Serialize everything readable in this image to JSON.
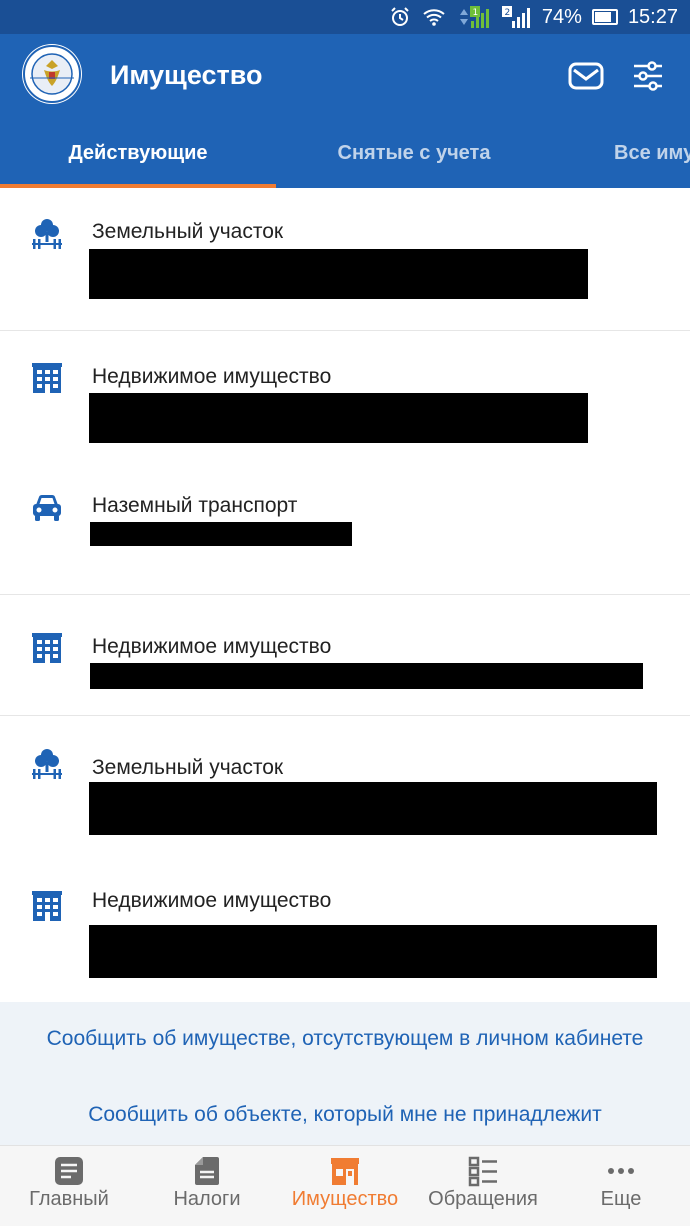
{
  "status_bar": {
    "battery": "74%",
    "time": "15:27",
    "sim1": "1",
    "sim2": "2"
  },
  "app_bar": {
    "title": "Имущество"
  },
  "tabs": [
    {
      "label": "Действующие",
      "active": true
    },
    {
      "label": "Снятые с учета",
      "active": false
    },
    {
      "label": "Все иму",
      "active": false
    }
  ],
  "items": [
    {
      "label": "Земельный участок",
      "icon": "tree-fence-icon"
    },
    {
      "label": "Недвижимое имущество",
      "icon": "building-icon"
    },
    {
      "label": "Наземный транспорт",
      "icon": "car-icon"
    },
    {
      "label": "Недвижимое имущество",
      "icon": "building-icon"
    },
    {
      "label": "Земельный участок",
      "icon": "tree-fence-icon"
    },
    {
      "label": "Недвижимое имущество",
      "icon": "building-icon"
    }
  ],
  "footer_links": {
    "report_missing": "Сообщить об имуществе, отсутствующем в личном кабинете",
    "report_not_mine": "Сообщить об объекте, который мне не принадлежит"
  },
  "bottom_nav": [
    {
      "label": "Главный",
      "icon": "home-doc-icon",
      "active": false
    },
    {
      "label": "Налоги",
      "icon": "document-icon",
      "active": false
    },
    {
      "label": "Имущество",
      "icon": "house-icon",
      "active": true
    },
    {
      "label": "Обращения",
      "icon": "list-icon",
      "active": false
    },
    {
      "label": "Еще",
      "icon": "more-icon",
      "active": false
    }
  ],
  "colors": {
    "primary": "#1f63b5",
    "accent": "#f07c32",
    "status_bar": "#1a4f95",
    "redaction": "#000000"
  }
}
